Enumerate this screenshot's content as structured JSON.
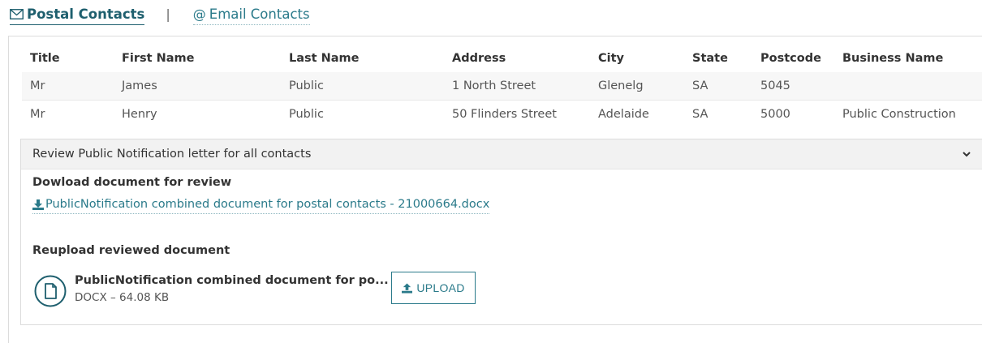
{
  "tabs": [
    {
      "label": "Postal Contacts",
      "icon": "envelope-icon",
      "active": true
    },
    {
      "label": "Email Contacts",
      "icon": "at-icon",
      "active": false
    }
  ],
  "separator": "|",
  "table": {
    "headers": [
      "Title",
      "First Name",
      "Last Name",
      "Address",
      "City",
      "State",
      "Postcode",
      "Business Name"
    ],
    "rows": [
      [
        "Mr",
        "James",
        "Public",
        "1 North Street",
        "Glenelg",
        "SA",
        "5045",
        ""
      ],
      [
        "Mr",
        "Henry",
        "Public",
        "50 Flinders Street",
        "Adelaide",
        "SA",
        "5000",
        "Public Construction"
      ]
    ]
  },
  "review": {
    "header": "Review Public Notification letter for all contacts",
    "download_title": "Dowload document for review",
    "download_link": "PublicNotification combined document for postal contacts - 21000664.docx",
    "reupload_title": "Reupload reviewed document",
    "file_name": "PublicNotification combined document for po...",
    "file_meta": "DOCX – 64.08 KB",
    "upload_label": "UPLOAD"
  },
  "colors": {
    "accent": "#2a7a8a",
    "accent_dark": "#1e5f6e",
    "row_alt": "#f7f7f7",
    "header_bg": "#f2f2f2"
  }
}
